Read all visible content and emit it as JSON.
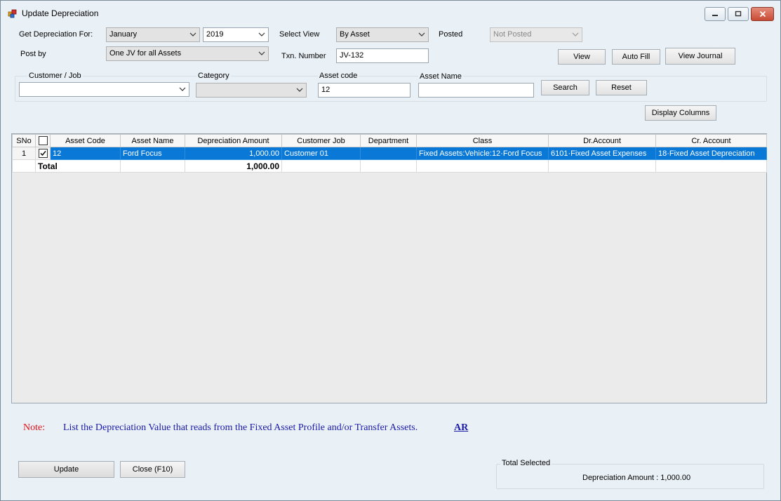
{
  "window": {
    "title": "Update Depreciation"
  },
  "filters": {
    "get_depreciation_for_label": "Get Depreciation For:",
    "month": "January",
    "year": "2019",
    "select_view_label": "Select View",
    "select_view": "By Asset",
    "posted_label": "Posted",
    "posted": "Not Posted",
    "post_by_label": "Post by",
    "post_by": "One JV for all Assets",
    "txn_number_label": "Txn. Number",
    "txn_number": "JV-132"
  },
  "buttons": {
    "view": "View",
    "auto_fill": "Auto Fill",
    "view_journal": "View Journal",
    "search": "Search",
    "reset": "Reset",
    "display_columns": "Display Columns",
    "update": "Update",
    "close": "Close (F10)"
  },
  "search": {
    "customer_job_label": "Customer / Job",
    "customer_job": "",
    "category_label": "Category",
    "category": "",
    "asset_code_label": "Asset code",
    "asset_code": "12",
    "asset_name_label": "Asset Name",
    "asset_name": ""
  },
  "grid": {
    "columns": [
      "SNo",
      "",
      "Asset Code",
      "Asset Name",
      "Depreciation Amount",
      "Customer Job",
      "Department",
      "Class",
      "Dr.Account",
      "Cr. Account"
    ],
    "rows": [
      {
        "sno": "1",
        "checked": true,
        "asset_code": "12",
        "asset_name": "Ford Focus",
        "depreciation_amount": "1,000.00",
        "customer_job": "Customer 01",
        "department": "",
        "class": "Fixed Assets:Vehicle:12·Ford Focus",
        "dr_account": "6101·Fixed Asset Expenses",
        "cr_account": "18·Fixed Asset Depreciation"
      }
    ],
    "total_label": "Total",
    "total_amount": "1,000.00"
  },
  "note": {
    "label": "Note:",
    "text": "List the Depreciation Value that reads from the Fixed Asset Profile and/or Transfer Assets.",
    "link": "AR"
  },
  "summary": {
    "title": "Total Selected",
    "depreciation_amount": "Depreciation Amount : 1,000.00"
  },
  "colors": {
    "selection": "#0a78d7",
    "note_label": "#e0101a",
    "note_text": "#1a1aa8"
  }
}
